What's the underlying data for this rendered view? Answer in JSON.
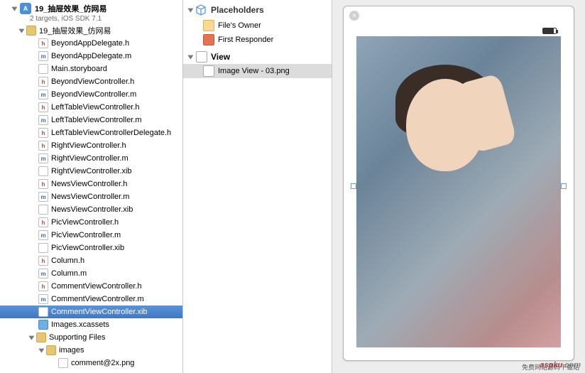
{
  "project": {
    "name": "19_抽屉效果_仿网易",
    "subtitle": "2 targets, iOS SDK 7.1"
  },
  "tree": [
    {
      "depth": 1,
      "type": "folder",
      "label": "19_抽屉效果_仿网易",
      "open": true
    },
    {
      "depth": 2,
      "type": "h",
      "label": "BeyondAppDelegate.h"
    },
    {
      "depth": 2,
      "type": "m",
      "label": "BeyondAppDelegate.m"
    },
    {
      "depth": 2,
      "type": "sb",
      "label": "Main.storyboard"
    },
    {
      "depth": 2,
      "type": "h",
      "label": "BeyondViewController.h"
    },
    {
      "depth": 2,
      "type": "m",
      "label": "BeyondViewController.m"
    },
    {
      "depth": 2,
      "type": "h",
      "label": "LeftTableViewController.h"
    },
    {
      "depth": 2,
      "type": "m",
      "label": "LeftTableViewController.m"
    },
    {
      "depth": 2,
      "type": "h",
      "label": "LeftTableViewControllerDelegate.h"
    },
    {
      "depth": 2,
      "type": "h",
      "label": "RightViewController.h"
    },
    {
      "depth": 2,
      "type": "m",
      "label": "RightViewController.m"
    },
    {
      "depth": 2,
      "type": "xib",
      "label": "RightViewController.xib"
    },
    {
      "depth": 2,
      "type": "h",
      "label": "NewsViewController.h"
    },
    {
      "depth": 2,
      "type": "m",
      "label": "NewsViewController.m"
    },
    {
      "depth": 2,
      "type": "xib",
      "label": "NewsViewController.xib"
    },
    {
      "depth": 2,
      "type": "h",
      "label": "PicViewController.h"
    },
    {
      "depth": 2,
      "type": "m",
      "label": "PicViewController.m"
    },
    {
      "depth": 2,
      "type": "xib",
      "label": "PicViewController.xib"
    },
    {
      "depth": 2,
      "type": "h",
      "label": "Column.h"
    },
    {
      "depth": 2,
      "type": "m",
      "label": "Column.m"
    },
    {
      "depth": 2,
      "type": "h",
      "label": "CommentViewController.h"
    },
    {
      "depth": 2,
      "type": "m",
      "label": "CommentViewController.m"
    },
    {
      "depth": 2,
      "type": "xib",
      "label": "CommentViewController.xib",
      "selected": true
    },
    {
      "depth": 2,
      "type": "xc",
      "label": "Images.xcassets"
    },
    {
      "depth": 2,
      "type": "folder",
      "label": "Supporting Files",
      "open": true
    },
    {
      "depth": 3,
      "type": "folder",
      "label": "images",
      "open": true
    },
    {
      "depth": 4,
      "type": "png",
      "label": "comment@2x.png"
    }
  ],
  "outline": {
    "placeholders": "Placeholders",
    "owner": "File's Owner",
    "responder": "First Responder",
    "view": "View",
    "imageview": "Image View - 03.png"
  },
  "watermark": {
    "main": "aspku",
    "suffix": ".com",
    "sub": "免费网站源码下载站"
  }
}
